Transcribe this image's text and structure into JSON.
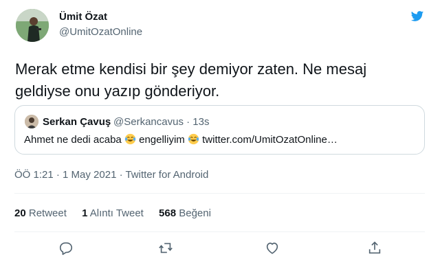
{
  "author": {
    "name": "Ümit Özat",
    "handle": "@UmitOzatOnline"
  },
  "tweet": {
    "text": "Merak etme kendisi bir şey demiyor zaten. Ne mesaj geldiyse onu yazıp gönderiyor."
  },
  "quote": {
    "name": "Serkan Çavuş",
    "handle": "@Serkancavus · 13s",
    "text_part1": "Ahmet ne dedi acaba ",
    "text_part2": " engelliyim ",
    "text_part3": " twitter.com/UmitOzatOnline…",
    "emoji_icon": "face-with-tears-of-joy"
  },
  "meta": {
    "timestamp": "ÖÖ 1:21 · 1 May 2021 · Twitter for Android"
  },
  "stats": {
    "retweets_count": "20",
    "retweets_label": " Retweet",
    "quotes_count": "1",
    "quotes_label": " Alıntı Tweet",
    "likes_count": "568",
    "likes_label": " Beğeni"
  },
  "actions": {
    "reply_icon": "reply-icon",
    "retweet_icon": "retweet-icon",
    "like_icon": "heart-icon",
    "share_icon": "share-icon"
  },
  "colors": {
    "text": "#0f1419",
    "secondary": "#536471",
    "border": "#cfd9de",
    "divider": "#eff3f4"
  }
}
